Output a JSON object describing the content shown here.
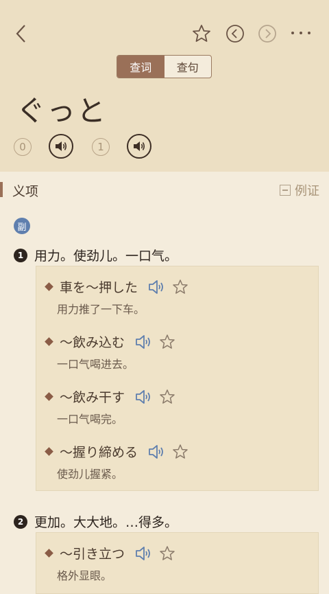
{
  "toolbar": {
    "icons": [
      "back-icon",
      "star-icon",
      "previous-icon",
      "next-icon",
      "more-icon"
    ]
  },
  "segment": {
    "word_tab": "查词",
    "sentence_tab": "查句",
    "active": "word"
  },
  "entry": {
    "headword": "ぐっと",
    "pitch": [
      "0",
      "1"
    ]
  },
  "section": {
    "title": "义项",
    "example_toggle": "例证"
  },
  "pos_badge": "副",
  "senses": [
    {
      "num": "1",
      "definition": "用力。使劲儿。一口气。",
      "examples": [
        {
          "jp": "車を～押した",
          "cn": "用力推了一下车。"
        },
        {
          "jp": "～飲み込む",
          "cn": "一口气喝进去。"
        },
        {
          "jp": "～飲み干す",
          "cn": "一口气喝完。"
        },
        {
          "jp": "～握り締める",
          "cn": "使劲儿握紧。"
        }
      ]
    },
    {
      "num": "2",
      "definition": "更加。大大地。…得多。",
      "examples": [
        {
          "jp": "～引き立つ",
          "cn": "格外显眼。"
        }
      ]
    }
  ],
  "colors": {
    "header_bg": "#ecdfc3",
    "page_bg": "#f4ecdc",
    "accent": "#9a7058",
    "speaker_blue": "#5f7fae"
  }
}
